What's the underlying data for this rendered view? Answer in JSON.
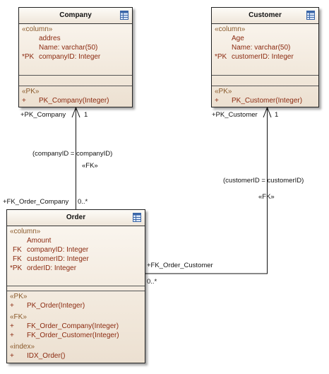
{
  "classes": {
    "company": {
      "name": "Company",
      "icon": "table-icon",
      "columns_stereotype": "«column»",
      "columns": [
        {
          "marker": "",
          "text": "addres"
        },
        {
          "marker": "",
          "text": "Name:  varchar(50)"
        },
        {
          "marker": "*PK",
          "text": "companyID:  Integer"
        }
      ],
      "pk_stereotype": "«PK»",
      "pk_ops": [
        {
          "marker": "+",
          "text": "PK_Company(Integer)"
        }
      ]
    },
    "customer": {
      "name": "Customer",
      "icon": "table-icon",
      "columns_stereotype": "«column»",
      "columns": [
        {
          "marker": "",
          "text": "Age"
        },
        {
          "marker": "",
          "text": "Name:  varchar(50)"
        },
        {
          "marker": "*PK",
          "text": "customerID:  Integer"
        }
      ],
      "pk_stereotype": "«PK»",
      "pk_ops": [
        {
          "marker": "+",
          "text": "PK_Customer(Integer)"
        }
      ]
    },
    "order": {
      "name": "Order",
      "icon": "table-icon",
      "columns_stereotype": "«column»",
      "columns": [
        {
          "marker": "",
          "text": "Amount"
        },
        {
          "marker": "FK",
          "text": "companyID:  Integer"
        },
        {
          "marker": "FK",
          "text": "customerID:  Integer"
        },
        {
          "marker": "*PK",
          "text": "orderID:  Integer"
        }
      ],
      "pk_stereotype": "«PK»",
      "pk_ops": [
        {
          "marker": "+",
          "text": "PK_Order(Integer)"
        }
      ],
      "fk_stereotype": "«FK»",
      "fk_ops": [
        {
          "marker": "+",
          "text": "FK_Order_Company(Integer)"
        },
        {
          "marker": "+",
          "text": "FK_Order_Customer(Integer)"
        }
      ],
      "index_stereotype": "«index»",
      "index_ops": [
        {
          "marker": "+",
          "text": "IDX_Order()"
        }
      ]
    }
  },
  "connectors": {
    "company_order": {
      "source_role": "+FK_Order_Company",
      "source_mult": "0..*",
      "target_role": "+PK_Company",
      "target_mult": "1",
      "constraint": "(companyID = companyID)",
      "stereotype": "«FK»"
    },
    "customer_order": {
      "source_role": "+FK_Order_Customer",
      "source_mult": "0..*",
      "target_role": "+PK_Customer",
      "target_mult": "1",
      "constraint": "(customerID = customerID)",
      "stereotype": "«FK»"
    }
  },
  "colors": {
    "attribute_text": "#8b2a10",
    "stereotype_text": "#8a5a2b",
    "class_fill": "#f1e7da",
    "line": "#111111"
  }
}
